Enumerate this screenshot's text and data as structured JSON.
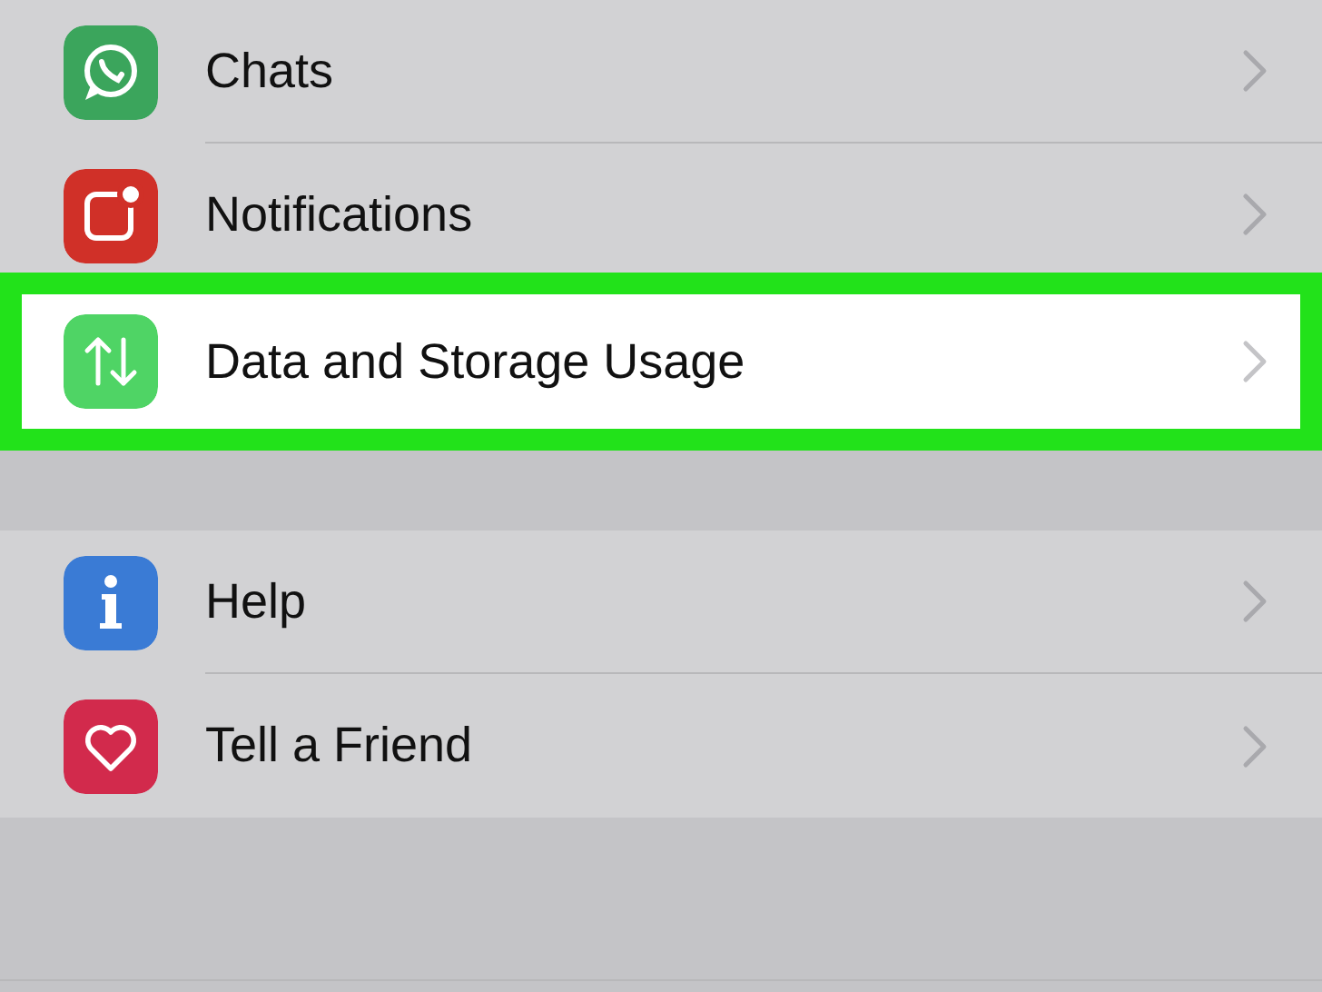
{
  "sections": [
    {
      "rows": [
        {
          "label": "Chats",
          "kind": "chat",
          "color": "#3ba55c",
          "selected": false
        },
        {
          "label": "Notifications",
          "kind": "notification",
          "color": "#d03028",
          "selected": false
        },
        {
          "label": "Data and Storage Usage",
          "kind": "data",
          "color": "#4fd465",
          "selected": true
        }
      ]
    },
    {
      "rows": [
        {
          "label": "Help",
          "kind": "info",
          "color": "#3a7bd5",
          "selected": false
        },
        {
          "label": "Tell a Friend",
          "kind": "heart",
          "color": "#d22a4c",
          "selected": false
        }
      ]
    }
  ]
}
